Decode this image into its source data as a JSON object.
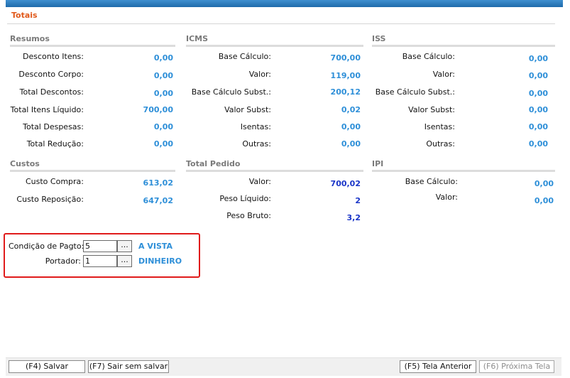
{
  "title": "Totais",
  "resumos": {
    "header": "Resumos",
    "rows": [
      {
        "label": "Desconto Itens:",
        "value": "0,00"
      },
      {
        "label": "Desconto Corpo:",
        "value": "0,00"
      },
      {
        "label": "Total Descontos:",
        "value": "0,00"
      },
      {
        "label": "Total Itens Líquido:",
        "value": "700,00"
      },
      {
        "label": "Total Despesas:",
        "value": "0,00"
      },
      {
        "label": "Total Redução:",
        "value": "0,00"
      }
    ]
  },
  "icms": {
    "header": "ICMS",
    "rows": [
      {
        "label": "Base Cálculo:",
        "value": "700,00"
      },
      {
        "label": "Valor:",
        "value": "119,00"
      },
      {
        "label": "Base Cálculo Subst.:",
        "value": "200,12"
      },
      {
        "label": "Valor Subst:",
        "value": "0,02"
      },
      {
        "label": "Isentas:",
        "value": "0,00"
      },
      {
        "label": "Outras:",
        "value": "0,00"
      }
    ]
  },
  "iss": {
    "header": "ISS",
    "rows": [
      {
        "label": "Base Cálculo:",
        "value": "0,00"
      },
      {
        "label": "Valor:",
        "value": "0,00"
      },
      {
        "label": "Base Cálculo Subst.:",
        "value": "0,00"
      },
      {
        "label": "Valor Subst:",
        "value": "0,00"
      },
      {
        "label": "Isentas:",
        "value": "0,00"
      },
      {
        "label": "Outras:",
        "value": "0,00"
      }
    ]
  },
  "custos": {
    "header": "Custos",
    "rows": [
      {
        "label": "Custo Compra:",
        "value": "613,02"
      },
      {
        "label": "Custo Reposição:",
        "value": "647,02"
      }
    ]
  },
  "total_pedido": {
    "header": "Total Pedido",
    "rows": [
      {
        "label": "Valor:",
        "value": "700,02"
      },
      {
        "label": "Peso Líquido:",
        "value": "2"
      },
      {
        "label": "Peso Bruto:",
        "value": "3,2"
      }
    ]
  },
  "ipi": {
    "header": "IPI",
    "rows": [
      {
        "label": "Base Cálculo:",
        "value": "0,00"
      },
      {
        "label": "Valor:",
        "value": "0,00"
      }
    ]
  },
  "pagamento": {
    "condicao_label": "Condição de Pagto:",
    "condicao_value": "5",
    "condicao_desc": "A VISTA",
    "portador_label": "Portador:",
    "portador_value": "1",
    "portador_desc": "DINHEIRO",
    "lookup_label": "..."
  },
  "footer": {
    "salvar": "(F4) Salvar",
    "sair": "(F7) Sair sem salvar",
    "anterior": "(F5) Tela Anterior",
    "proxima": "(F6) Próxima Tela"
  },
  "colors": {
    "title": "#e0591b",
    "value_blue": "#2e8fd8",
    "value_dark_blue": "#1a35c8",
    "highlight_border": "#e01b1b",
    "topbar": "#1e6aaa"
  }
}
